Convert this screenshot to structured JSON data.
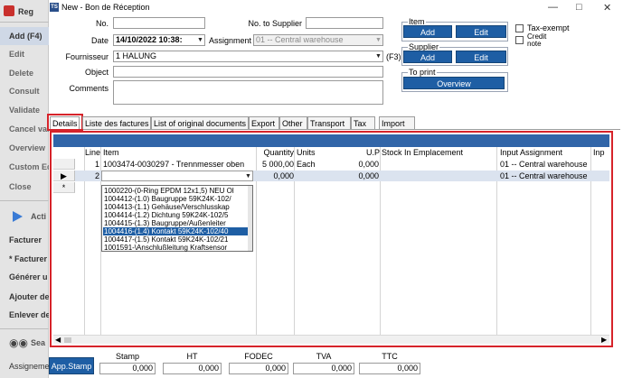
{
  "window": {
    "title": "New - Bon de Réception",
    "app_badge": "TS"
  },
  "sidebar": {
    "top_label": "Reg",
    "items": [
      "Add (F4)",
      "Edit",
      "Delete",
      "Consult",
      "Validate",
      "Cancel val",
      "Overview",
      "Custom Ed",
      "Close"
    ],
    "actions_label": "Acti",
    "action_items": [
      "Facturer",
      "* Facturer",
      "Générer u",
      "Ajouter de",
      "Enlever de"
    ],
    "search_label": "Sea",
    "bottom_label": "Assigneme"
  },
  "form": {
    "no_label": "No.",
    "no_value": "",
    "no_supplier_label": "No. to Supplier",
    "no_supplier_value": "",
    "date_label": "Date",
    "date_value": "14/10/2022 10:38:",
    "assignment_label": "Assignment",
    "assignment_value": "01 -- Central warehouse",
    "fournisseur_label": "Fournisseur",
    "fournisseur_value": "1 HALUNG",
    "f3_label": "(F3)",
    "object_label": "Object",
    "object_value": "",
    "comments_label": "Comments",
    "comments_value": ""
  },
  "groups": {
    "item_title": "Item",
    "item_add": "Add",
    "item_edit": "Edit",
    "supplier_title": "Supplier",
    "supplier_add": "Add",
    "supplier_edit": "Edit",
    "print_title": "To print",
    "overview": "Overview"
  },
  "checkboxes": {
    "tax_exempt": "Tax-exempt",
    "credit_note_1": "Credit",
    "credit_note_2": "note"
  },
  "tabs": [
    "Details",
    "Liste des factures",
    "List of original documents",
    "Export",
    "Other",
    "Transport",
    "Tax",
    "Import"
  ],
  "grid": {
    "columns": [
      "Line",
      "Item",
      "Quantity",
      "Units",
      "U.P",
      "Stock In Emplacement",
      "Input Assignment",
      "Inp"
    ],
    "rows": [
      {
        "line": "1",
        "item": "1003474-0030297 - Trennmesser oben",
        "quantity": "5 000,00",
        "units": "Each",
        "up": "0,000",
        "stock": "",
        "assignment": "01 -- Central warehouse"
      },
      {
        "line": "2",
        "item": "",
        "quantity": "0,000",
        "units": "",
        "up": "0,000",
        "stock": "",
        "assignment": "01 -- Central warehouse"
      }
    ],
    "new_row_marker": "*",
    "dropdown_options": [
      "1000220-(0-Ring EPDM 12x1,5) NEU Ol",
      "1004412-(1.0) Baugruppe 59K24K-102/",
      "1004413-(1.1) Gehäuse/Verschlusskap",
      "1004414-(1.2) Dichtung 59K24K-102/5",
      "1004415-(1.3) Baugruppe/Außenleiter",
      "1004416-(1.4) Kontakt 59K24K-102/40",
      "1004417-(1.5) Kontakt 59K24K-102/21",
      "1001591-\\Anschlußleitung Kraftsensor"
    ],
    "dropdown_selected_index": 5
  },
  "footer": {
    "app_stamp": "App.Stamp",
    "labels": [
      "Stamp",
      "HT",
      "FODEC",
      "TVA",
      "TTC"
    ],
    "values": [
      "0,000",
      "0,000",
      "0,000",
      "0,000",
      "0,000"
    ]
  },
  "colors": {
    "accent": "#1e5ea4",
    "highlight_box": "#d6232a"
  }
}
